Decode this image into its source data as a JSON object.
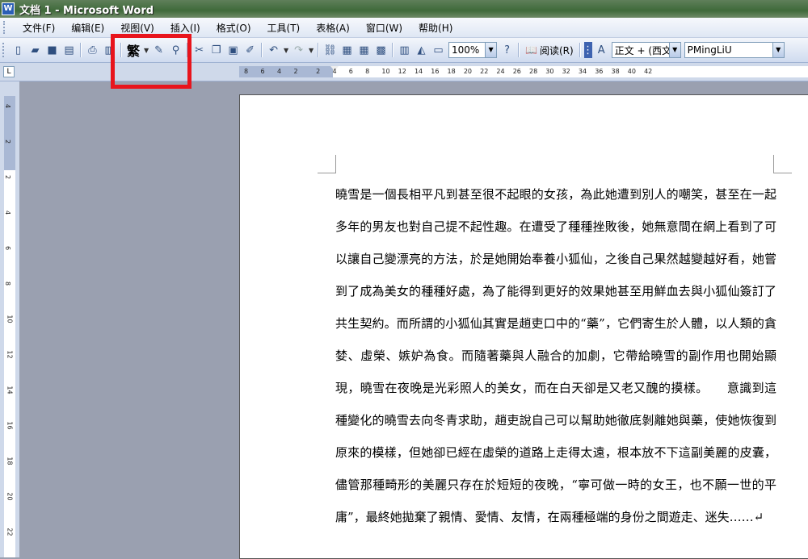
{
  "window": {
    "title": "文档 1 - Microsoft Word",
    "app_icon": "W"
  },
  "menu": [
    "文件(F)",
    "编辑(E)",
    "视图(V)",
    "插入(I)",
    "格式(O)",
    "工具(T)",
    "表格(A)",
    "窗口(W)",
    "帮助(H)"
  ],
  "toolbar": {
    "traditional_label": "繁",
    "zoom_value": "100%",
    "read_label": "阅读(R)",
    "style_value": "正文 + (西文",
    "font_value": "PMingLiU"
  },
  "ruler": {
    "corner": "L",
    "h_ticks": [
      "8",
      "6",
      "4",
      "2",
      "2",
      "4",
      "6",
      "8",
      "10",
      "12",
      "14",
      "16",
      "18",
      "20",
      "22",
      "24",
      "26",
      "28",
      "30",
      "32",
      "34",
      "36",
      "38",
      "40",
      "42"
    ],
    "v_ticks": [
      "4",
      "2",
      "2",
      "4",
      "6",
      "8",
      "10",
      "12",
      "14",
      "16",
      "18",
      "20",
      "22"
    ]
  },
  "document": {
    "body": "曉雪是一個長相平凡到甚至很不起眼的女孩，為此她遭到別人的嘲笑，甚至在一起多年的男友也對自己提不起性趣。在遭受了種種挫敗後，她無意間在網上看到了可以讓自己變漂亮的方法，於是她開始奉養小狐仙，之後自己果然越變越好看，她嘗到了成為美女的種種好處，為了能得到更好的效果她甚至用鮮血去與小狐仙簽訂了共生契約。而所謂的小狐仙其實是趙吏口中的“藥”，它們寄生於人體，以人類的貪婪、虛榮、嫉妒為食。而隨著藥與人融合的加劇，它帶給曉雪的副作用也開始顯現，曉雪在夜晚是光彩照人的美女，而在白天卻是又老又醜的摸樣。　　意識到這種變化的曉雪去向冬青求助，趙吏說自己可以幫助她徹底剝離她與藥，使她恢復到原來的模樣，但她卻已經在虛榮的道路上走得太遠，根本放不下這副美麗的皮囊，儘管那種畸形的美麗只存在於短短的夜晚，“寧可做一時的女王，也不願一世的平庸”，最終她拋棄了親情、愛情、友情，在兩種極端的身份之間遊走、迷失……↵"
  },
  "colors": {
    "highlight": "#e8141c",
    "title_bar": "#3f6a3a",
    "workspace": "#9aa0b0"
  }
}
